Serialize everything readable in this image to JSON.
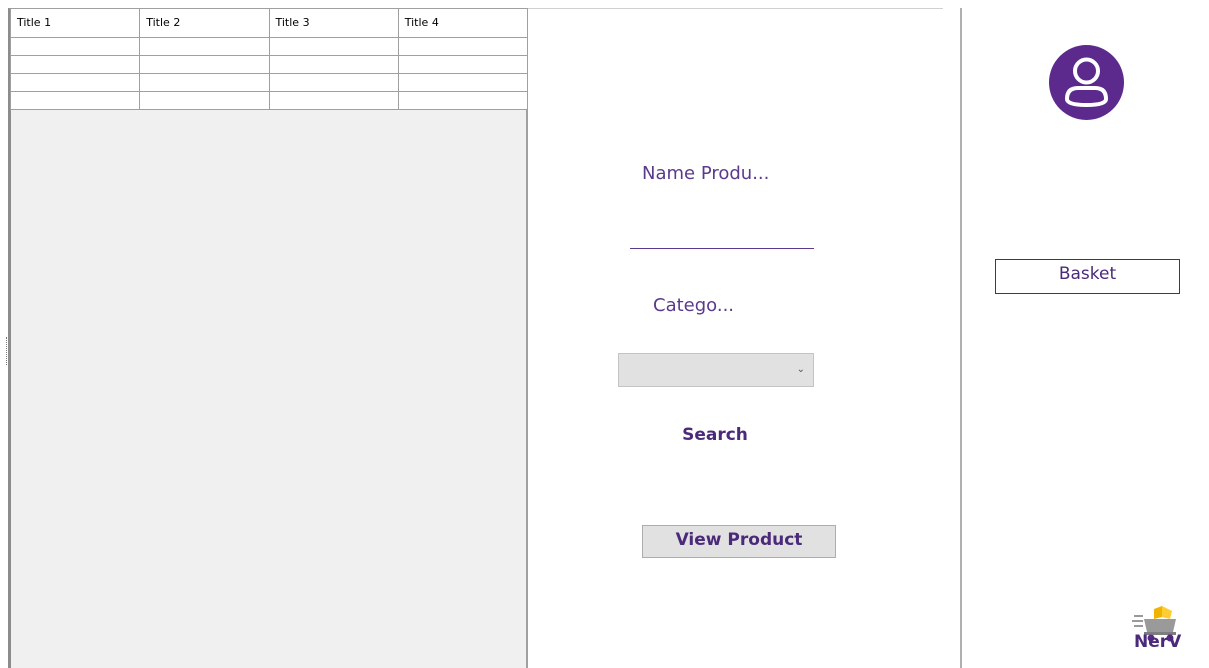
{
  "grid": {
    "columns": [
      "Title 1",
      "Title 2",
      "Title 3",
      "Title 4"
    ],
    "rows": [
      [
        "",
        "",
        "",
        ""
      ],
      [
        "",
        "",
        "",
        ""
      ],
      [
        "",
        "",
        "",
        ""
      ],
      [
        "",
        "",
        "",
        ""
      ]
    ]
  },
  "form": {
    "name_label": "Name Produ...",
    "name_value": "",
    "category_label": "Catego...",
    "category_value": "",
    "search_label": "Search",
    "view_product_label": "View Product"
  },
  "sidebar": {
    "avatar_icon": "user-icon",
    "basket_label": "Basket"
  },
  "brand": {
    "logo_icon": "delivery-cart-logo-icon",
    "name": "NerV"
  },
  "colors": {
    "accent": "#5b2a8c",
    "grid_background": "#f0f0f0",
    "button_gray": "#e1e1e1"
  }
}
